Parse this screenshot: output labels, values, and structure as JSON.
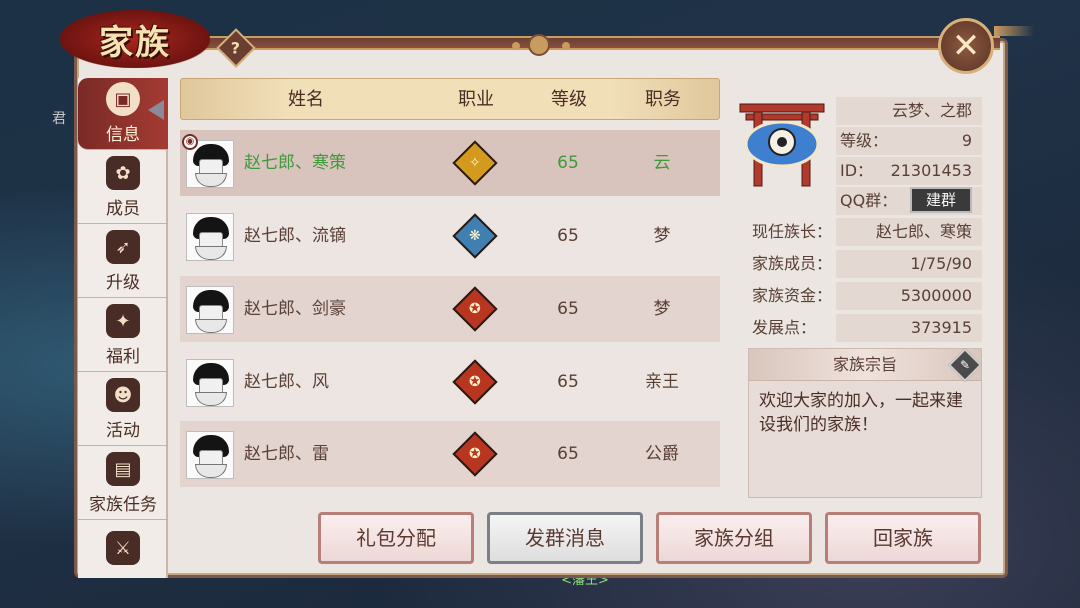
{
  "window": {
    "title": "家族",
    "help_label": "?",
    "close_label": "✕"
  },
  "sidebar": {
    "items": [
      {
        "label": "信息",
        "icon": "info-icon",
        "glyph": "▣"
      },
      {
        "label": "成员",
        "icon": "members-icon",
        "glyph": "✿"
      },
      {
        "label": "升级",
        "icon": "upgrade-icon",
        "glyph": "➶"
      },
      {
        "label": "福利",
        "icon": "gift-icon",
        "glyph": "✦"
      },
      {
        "label": "活动",
        "icon": "doll-icon",
        "glyph": "☻"
      },
      {
        "label": "家族任务",
        "icon": "scroll-icon",
        "glyph": "▤"
      },
      {
        "label": "",
        "icon": "crossed-swords-icon",
        "glyph": "⚔"
      }
    ]
  },
  "table": {
    "headers": {
      "name": "姓名",
      "class": "职业",
      "level": "等级",
      "position": "职务"
    },
    "rows": [
      {
        "name": "赵七郎、寒策",
        "class_color": "#d49a1e",
        "class_glyph": "✧",
        "level": "65",
        "position": "云"
      },
      {
        "name": "赵七郎、流镝",
        "class_color": "#3f7fb2",
        "class_glyph": "❋",
        "level": "65",
        "position": "梦"
      },
      {
        "name": "赵七郎、剑豪",
        "class_color": "#b8351f",
        "class_glyph": "✪",
        "level": "65",
        "position": "梦"
      },
      {
        "name": "赵七郎、风",
        "class_color": "#b8351f",
        "class_glyph": "✪",
        "level": "65",
        "position": "亲王"
      },
      {
        "name": "赵七郎、雷",
        "class_color": "#b8351f",
        "class_glyph": "✪",
        "level": "65",
        "position": "公爵"
      }
    ]
  },
  "family": {
    "name": "云梦、之郡",
    "level_label": "等级：",
    "level": "9",
    "id_label": "ID：",
    "id": "21301453",
    "qq_label": "QQ群：",
    "qq_button": "建群",
    "leader_label": "现任族长：",
    "leader": "赵七郎、寒策",
    "members_label": "家族成员：",
    "members": "1/75/90",
    "funds_label": "家族资金：",
    "funds": "5300000",
    "points_label": "发展点：",
    "points": "373915"
  },
  "motto": {
    "title": "家族宗旨",
    "text": "欢迎大家的加入，一起来建设我们的家族！"
  },
  "buttons": {
    "gift": "礼包分配",
    "group_message": "发群消息",
    "grouping": "家族分组",
    "return": "回家族"
  },
  "scene": {
    "npc_tag": "<藩王>",
    "left_text": "君"
  },
  "colors": {
    "accent": "#7a2a26",
    "self_name": "#3f9a3a",
    "panel": "#ece6e2"
  }
}
